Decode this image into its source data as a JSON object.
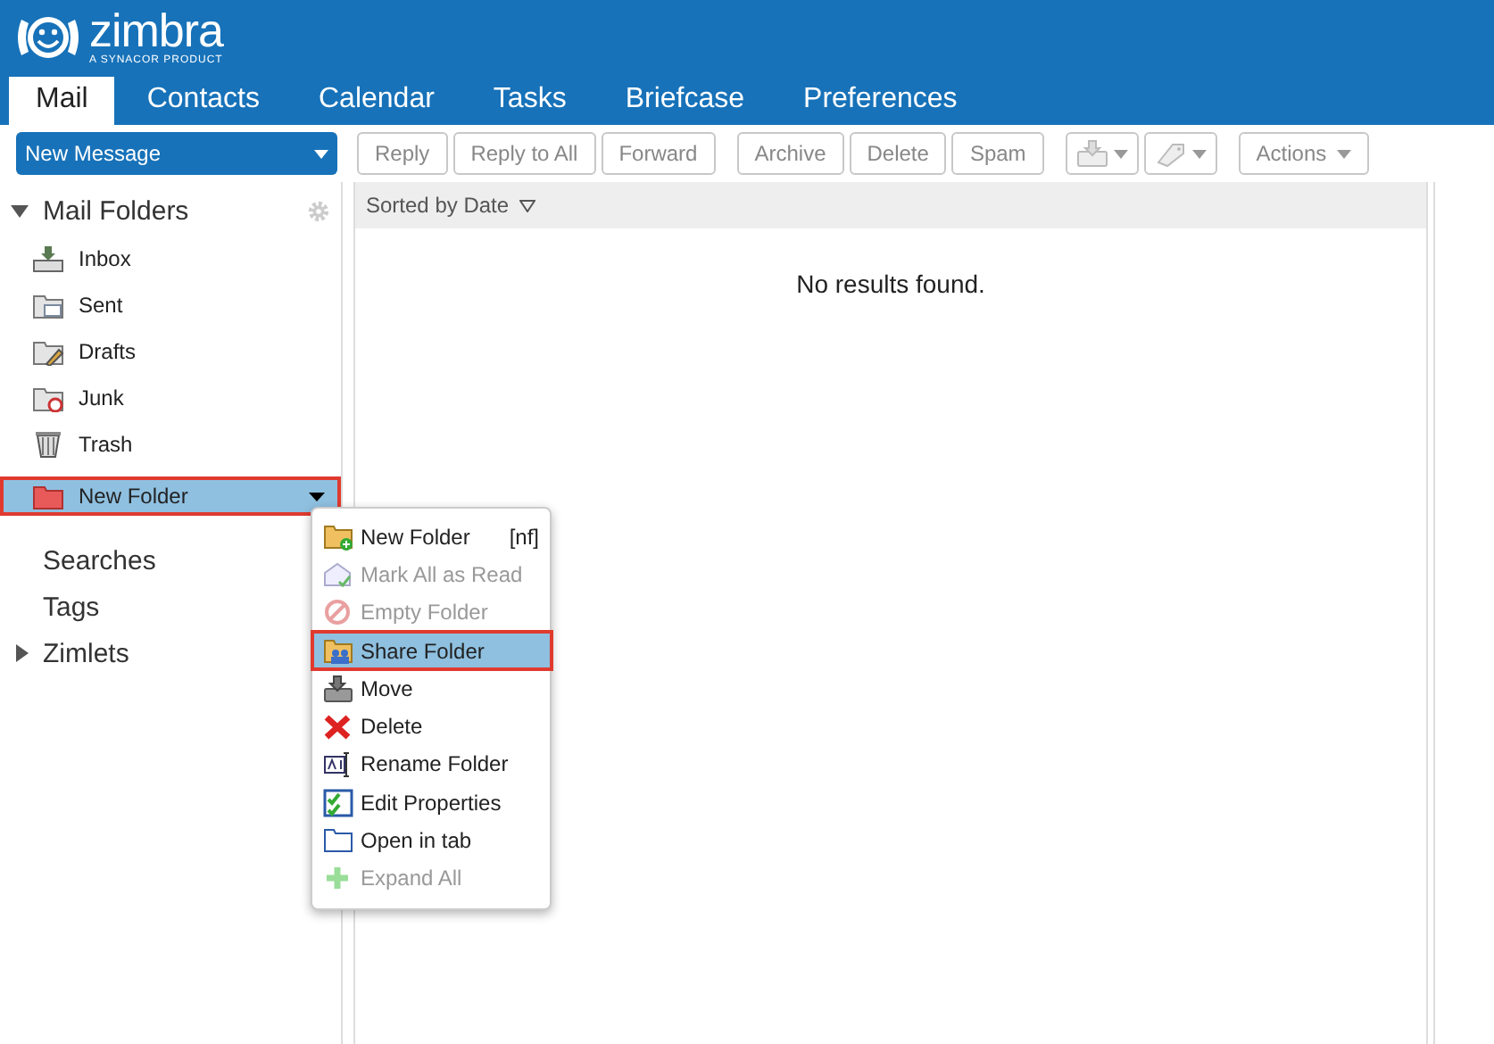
{
  "logo": {
    "name": "zimbra",
    "tagline": "A SYNACOR PRODUCT"
  },
  "tabs": [
    {
      "label": "Mail",
      "selected": true
    },
    {
      "label": "Contacts",
      "selected": false
    },
    {
      "label": "Calendar",
      "selected": false
    },
    {
      "label": "Tasks",
      "selected": false
    },
    {
      "label": "Briefcase",
      "selected": false
    },
    {
      "label": "Preferences",
      "selected": false
    }
  ],
  "new_message": {
    "label": "New Message"
  },
  "toolbar": [
    {
      "kind": "text",
      "label": "Reply"
    },
    {
      "kind": "text",
      "label": "Reply to All"
    },
    {
      "kind": "text",
      "label": "Forward"
    },
    {
      "kind": "gap"
    },
    {
      "kind": "text",
      "label": "Archive"
    },
    {
      "kind": "text",
      "label": "Delete"
    },
    {
      "kind": "text",
      "label": "Spam"
    },
    {
      "kind": "gap"
    },
    {
      "kind": "tray"
    },
    {
      "kind": "tag"
    },
    {
      "kind": "gap"
    },
    {
      "kind": "menu",
      "label": "Actions"
    }
  ],
  "sidebar": {
    "mail_folders": {
      "label": "Mail Folders",
      "expanded": true
    },
    "folders": [
      {
        "label": "Inbox",
        "kind": "inbox",
        "selected": false,
        "outlined": false
      },
      {
        "label": "Sent",
        "kind": "sent",
        "selected": false,
        "outlined": false
      },
      {
        "label": "Drafts",
        "kind": "drafts",
        "selected": false,
        "outlined": false
      },
      {
        "label": "Junk",
        "kind": "junk",
        "selected": false,
        "outlined": false
      },
      {
        "label": "Trash",
        "kind": "trash",
        "selected": false,
        "outlined": false
      },
      {
        "label": "New Folder",
        "kind": "user",
        "selected": true,
        "outlined": true
      }
    ],
    "sections": [
      {
        "label": "Searches"
      },
      {
        "label": "Tags"
      },
      {
        "label": "Zimlets",
        "expanded": false
      }
    ]
  },
  "list": {
    "sort_label": "Sorted by Date",
    "empty_message": "No results found."
  },
  "context_menu": [
    {
      "label": "New Folder",
      "shortcut": "[nf]",
      "kind": "new",
      "disabled": false,
      "selected": false,
      "outlined": false
    },
    {
      "label": "Mark All as Read",
      "kind": "read",
      "disabled": true,
      "selected": false,
      "outlined": false
    },
    {
      "label": "Empty Folder",
      "kind": "empty",
      "disabled": true,
      "selected": false,
      "outlined": false
    },
    {
      "label": "Share Folder",
      "kind": "share",
      "disabled": false,
      "selected": true,
      "outlined": true
    },
    {
      "label": "Move",
      "kind": "move",
      "disabled": false,
      "selected": false,
      "outlined": false
    },
    {
      "label": "Delete",
      "kind": "delete",
      "disabled": false,
      "selected": false,
      "outlined": false
    },
    {
      "label": "Rename Folder",
      "kind": "rename",
      "disabled": false,
      "selected": false,
      "outlined": false
    },
    {
      "label": "Edit Properties",
      "kind": "props",
      "disabled": false,
      "selected": false,
      "outlined": false
    },
    {
      "label": "Open in tab",
      "kind": "tab",
      "disabled": false,
      "selected": false,
      "outlined": false
    },
    {
      "label": "Expand All",
      "kind": "expand",
      "disabled": true,
      "selected": false,
      "outlined": false
    }
  ]
}
